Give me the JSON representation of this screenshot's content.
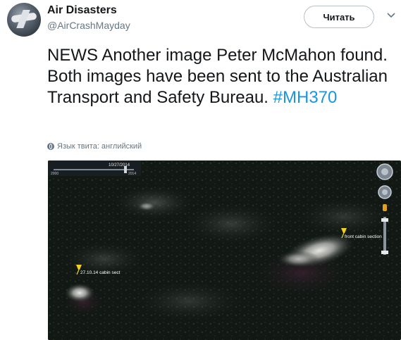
{
  "account": {
    "name": "Air Disasters",
    "handle": "@AirCrashMayday"
  },
  "actions": {
    "follow_label": "Читать"
  },
  "tweet": {
    "text": "NEWS Another image Peter McMahon found. Both images have been sent to the Australian Transport and Safety Bureau.",
    "hashtag": "#MH370"
  },
  "language": {
    "label": "Язык твита: английский"
  },
  "media": {
    "timeline_date": "10/27/2014",
    "timeline_start": "2000",
    "timeline_end": "2014",
    "pin_left_label": "27.10.14 cabin sect",
    "pin_right_label": "front cabin section"
  }
}
